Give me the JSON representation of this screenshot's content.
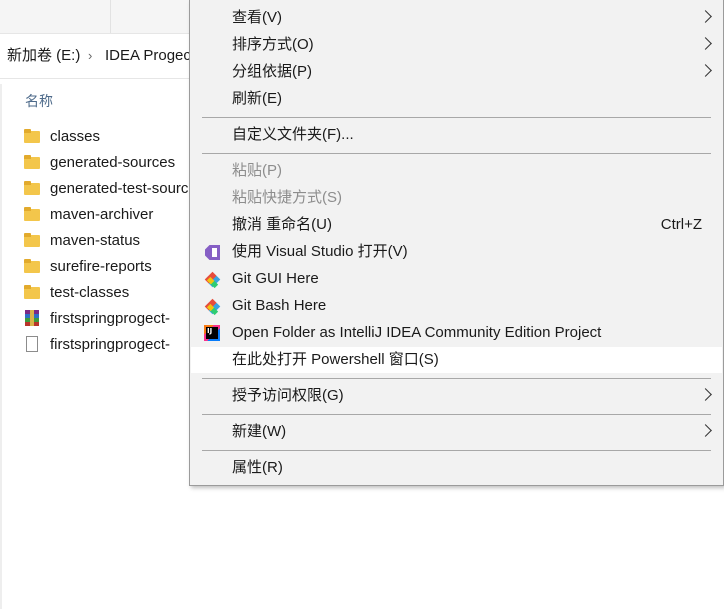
{
  "explorer": {
    "breadcrumb": [
      {
        "label": "新加卷 (E:)"
      },
      {
        "label": "IDEA Progect"
      }
    ],
    "column_header": "名称",
    "files": [
      {
        "name": "classes",
        "icon": "folder-icon"
      },
      {
        "name": "generated-sources",
        "icon": "folder-icon"
      },
      {
        "name": "generated-test-sources",
        "icon": "folder-icon"
      },
      {
        "name": "maven-archiver",
        "icon": "folder-icon"
      },
      {
        "name": "maven-status",
        "icon": "folder-icon"
      },
      {
        "name": "surefire-reports",
        "icon": "folder-icon"
      },
      {
        "name": "test-classes",
        "icon": "folder-icon"
      },
      {
        "name": "firstspringprogect-",
        "icon": "archive-icon"
      },
      {
        "name": "firstspringprogect-",
        "icon": "document-icon"
      }
    ]
  },
  "context_menu": {
    "view": "查看(V)",
    "sort_by": "排序方式(O)",
    "group_by": "分组依据(P)",
    "refresh": "刷新(E)",
    "customize_folder": "自定义文件夹(F)...",
    "paste": "粘贴(P)",
    "paste_shortcut": "粘贴快捷方式(S)",
    "undo_rename": "撤消 重命名(U)",
    "undo_shortcut": "Ctrl+Z",
    "open_visual_studio": "使用 Visual Studio 打开(V)",
    "git_gui": "Git GUI Here",
    "git_bash": "Git Bash Here",
    "open_intellij": "Open Folder as IntelliJ IDEA Community Edition Project",
    "open_powershell": "在此处打开 Powershell 窗口(S)",
    "grant_access": "授予访问权限(G)",
    "new": "新建(W)",
    "properties": "属性(R)"
  },
  "colors": {
    "menu_background": "#f2f2f2",
    "menu_hover": "#ffffff",
    "disabled_text": "#8d8d8d",
    "folder": "#f3c64b"
  }
}
